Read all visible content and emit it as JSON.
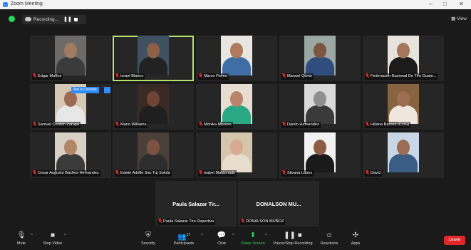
{
  "window": {
    "title": "Zoom Meeting",
    "controls": [
      "–",
      "□",
      "✕"
    ]
  },
  "topbar": {
    "recording_label": "Recording...",
    "pause_symbol": "❚❚",
    "view_label": "View"
  },
  "unmute_tag": "Ask to Unmute",
  "unmute_more": "...",
  "participants": [
    {
      "name": "Edgar Muñoz",
      "skin": "#a17a62",
      "shirt": "#3b3b3b",
      "bg": "#6d6a6a"
    },
    {
      "name": "Israel Blanco",
      "skin": "#8d5f45",
      "shirt": "#222222",
      "bg": "#3f5160",
      "active": true
    },
    {
      "name": "Marco Flores",
      "skin": "#b07a5c",
      "shirt": "#3f6ea6",
      "bg": "#e8e6e0"
    },
    {
      "name": "Manuel Quino",
      "skin": "#7d5440",
      "shirt": "#2f4d7e",
      "bg": "#9aa7a3"
    },
    {
      "name": "Federacion Nacional De Tiro Guate...",
      "skin": "#a4775b",
      "shirt": "#1b1b1b",
      "bg": "#e7e2db"
    },
    {
      "name": "Samuel Cordon Zarapa",
      "skin": "#9b6b52",
      "shirt": "#e7e7e7",
      "bg": "#d6c8b5"
    },
    {
      "name": "Mario Williams",
      "skin": "#6e4535",
      "shirt": "#1f1f1f",
      "bg": "#3a2a26"
    },
    {
      "name": "Mónika Moreno",
      "skin": "#b98467",
      "shirt": "#2aa784",
      "bg": "#e8ddd1"
    },
    {
      "name": "Danilo Hernandez",
      "skin": "#8f8f8f",
      "shirt": "#3a3a3a",
      "bg": "#d9d9d9"
    },
    {
      "name": "Hiliana Barnes (COG)",
      "skin": "#9f6e52",
      "shirt": "#efe7de",
      "bg": "#87643f"
    },
    {
      "name": "Cesar Augusto Baches Hernandez",
      "skin": "#b28667",
      "shirt": "#3b3b3b",
      "bg": "#d8d0c5"
    },
    {
      "name": "Edwin Adolfo Sac Tuj Solola",
      "skin": "#7d5240",
      "shirt": "#2d2d2d",
      "bg": "#4b3f3a"
    },
    {
      "name": "Isabel Maldonado",
      "skin": "#d8a98e",
      "shirt": "#e8dccc",
      "bg": "#d4c5ac"
    },
    {
      "name": "Silvana López",
      "skin": "#8e5d45",
      "shirt": "#1a1a1a",
      "bg": "#f2f2f2"
    },
    {
      "name": "David",
      "skin": "#9b6d52",
      "shirt": "#3a5d86",
      "bg": "#c9d6e5"
    }
  ],
  "nocam": [
    {
      "display": "Paula Salazar Tir...",
      "name": "Paula Salazar Tiro Deportivo"
    },
    {
      "display": "DONALSON MU...",
      "name": "DONALSON MUÑOZ"
    }
  ],
  "toolbar": {
    "mute": "Mute",
    "stop_video": "Stop Video",
    "security": "Security",
    "participants": "Participants",
    "participants_count": "17",
    "chat": "Chat",
    "share_screen": "Share Screen",
    "pause_stop_recording": "Pause/Stop Recording",
    "reactions": "Reactions",
    "apps": "Apps",
    "leave": "Leave"
  }
}
